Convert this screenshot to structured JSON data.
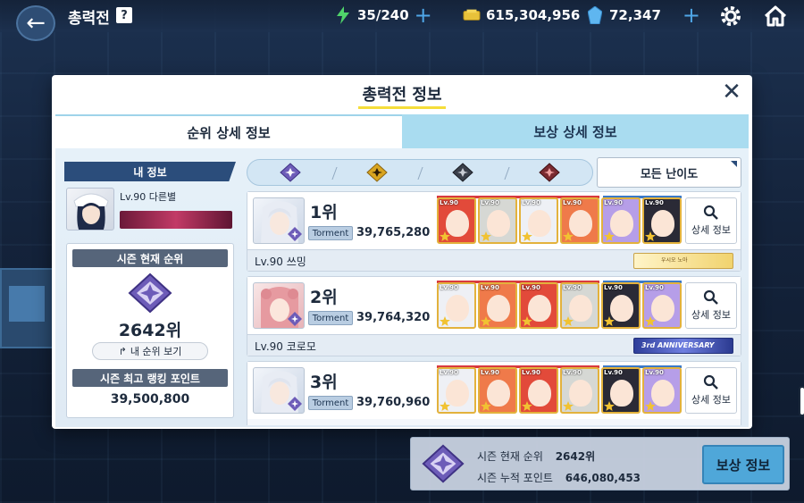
{
  "topbar": {
    "title": "총력전",
    "help": "?",
    "energy": "35/240",
    "gold": "615,304,956",
    "gems": "72,347",
    "icons": [
      "back-arrow-icon",
      "energy-icon",
      "gold-icon",
      "gem-icon",
      "plus-icon",
      "gear-icon",
      "home-icon"
    ]
  },
  "modal": {
    "title": "총력전 정보",
    "close": "✕",
    "tabs": [
      {
        "label": "순위 상세 정보",
        "active": true
      },
      {
        "label": "보상 상세 정보",
        "active": false
      }
    ]
  },
  "my_info": {
    "header": "내 정보",
    "level_name": "Lv.90 다른별",
    "season_rank_label": "시즌 현재 순위",
    "season_rank": "2642위",
    "my_rank_button": "내 순위 보기",
    "best_points_label": "시즌 최고 랭킹 포인트",
    "best_points": "39,500,800"
  },
  "filter": {
    "difficulties": [
      "difficulty-purple",
      "difficulty-gold",
      "difficulty-black",
      "difficulty-red"
    ],
    "selected": "모든 난이도"
  },
  "ranking": [
    {
      "rank": "1위",
      "mode": "Torment",
      "score": "39,765,280",
      "player": "Lv.90 쓰밍",
      "title_plate": "우시오 노아",
      "detail_label": "상세 정보"
    },
    {
      "rank": "2위",
      "mode": "Torment",
      "score": "39,764,320",
      "player": "Lv.90 코로모",
      "title_plate": "3rd ANNIVERSARY",
      "detail_label": "상세 정보"
    },
    {
      "rank": "3위",
      "mode": "Torment",
      "score": "39,760,960",
      "player": "",
      "title_plate": "",
      "detail_label": "상세 정보"
    }
  ],
  "status": {
    "current_rank_label": "시즌 현재 순위",
    "current_rank": "2642위",
    "total_points_label": "시즌 누적 포인트",
    "total_points": "646,080,453",
    "reward_button": "보상 정보"
  },
  "colors": {
    "accent_blue": "#4fa7d9",
    "header_navy": "#2b4d7b",
    "tab_inactive": "#a9dcf0",
    "highlight_yellow": "#f5dd3a",
    "team_red": "#d9393f",
    "team_blue": "#3a79c8"
  }
}
